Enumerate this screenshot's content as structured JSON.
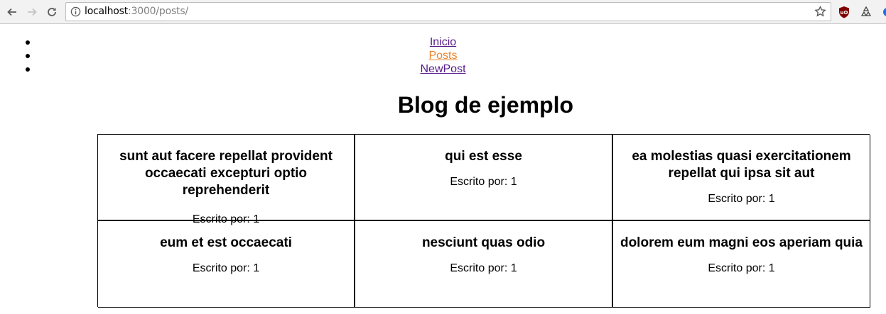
{
  "browser": {
    "url_host": "localhost",
    "url_path": ":3000/posts/"
  },
  "nav": {
    "items": [
      {
        "label": "Inicio",
        "state": "visited"
      },
      {
        "label": "Posts",
        "state": "active"
      },
      {
        "label": "NewPost",
        "state": "visited"
      }
    ]
  },
  "page": {
    "title": "Blog de ejemplo"
  },
  "posts": [
    {
      "title": "sunt aut facere repellat provident occaecati excepturi optio reprehenderit",
      "byline": "Escrito por: 1"
    },
    {
      "title": "qui est esse",
      "byline": "Escrito por: 1"
    },
    {
      "title": "ea molestias quasi exercitationem repellat qui ipsa sit aut",
      "byline": "Escrito por: 1"
    },
    {
      "title": "eum et est occaecati",
      "byline": "Escrito por: 1"
    },
    {
      "title": "nesciunt quas odio",
      "byline": "Escrito por: 1"
    },
    {
      "title": "dolorem eum magni eos aperiam quia",
      "byline": "Escrito por: 1"
    }
  ],
  "colors": {
    "visited_link": "#551a8b",
    "active_link": "#e8832a"
  }
}
